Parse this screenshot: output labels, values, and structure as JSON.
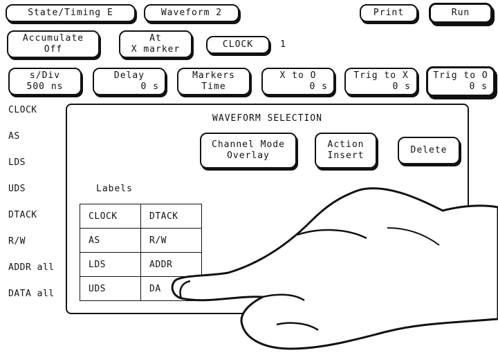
{
  "top_row": {
    "state_timing": "State/Timing E",
    "waveform": "Waveform 2",
    "print": "Print",
    "run": "Run"
  },
  "second_row": {
    "accumulate_line1": "Accumulate",
    "accumulate_line2": "Off",
    "at_line1": "At",
    "at_line2": "X marker",
    "clock_label": "CLOCK",
    "clock_value": "1"
  },
  "third_row": {
    "sdiv_label": "s/Div",
    "sdiv_value": "500 ns",
    "delay_label": "Delay",
    "delay_value": "0  s",
    "markers_label": "Markers",
    "markers_value": "Time",
    "xto0_label": "X to O",
    "xto0_value": "0  s",
    "trigx_label": "Trig to X",
    "trigx_value": "0  s",
    "trig0_label": "Trig to O",
    "trig0_value": "0  s"
  },
  "signals": [
    "CLOCK",
    "AS",
    "LDS",
    "UDS",
    "DTACK",
    "R/W",
    "ADDR  all",
    "DATA  all"
  ],
  "panel": {
    "title": "WAVEFORM SELECTION",
    "channel_mode_label": "Channel Mode",
    "channel_mode_value": "Overlay",
    "action_label": "Action",
    "action_value": "Insert",
    "delete": "Delete",
    "labels_heading": "Labels",
    "labels_table": [
      [
        "CLOCK",
        "DTACK"
      ],
      [
        "AS",
        "R/W"
      ],
      [
        "LDS",
        "ADDR"
      ],
      [
        "UDS",
        "DA"
      ]
    ]
  }
}
